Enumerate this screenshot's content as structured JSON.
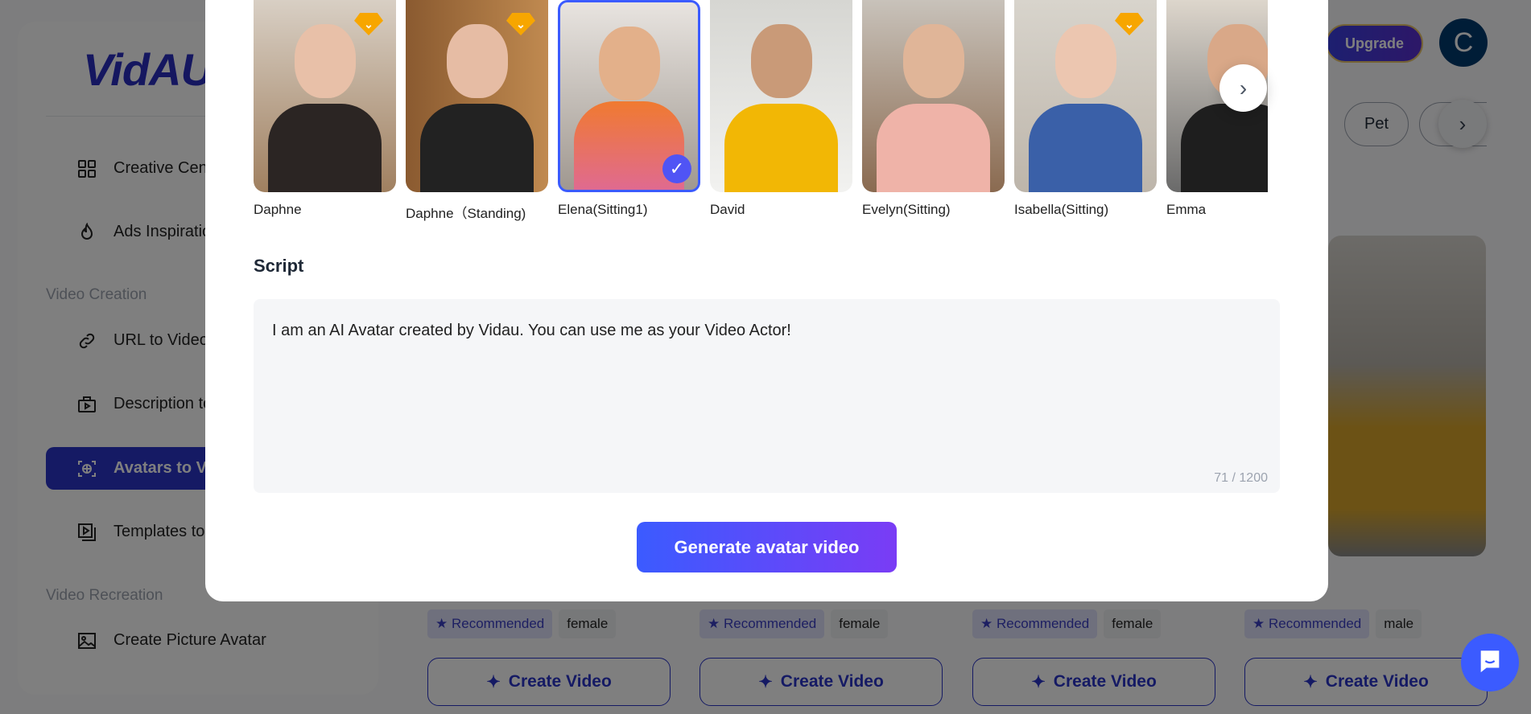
{
  "app": {
    "logo": "VidAU",
    "upgrade": "Upgrade",
    "user_initial": "C"
  },
  "sidebar": {
    "items": [
      {
        "label": "Creative Center",
        "icon": "grid-icon"
      },
      {
        "label": "Ads Inspiration",
        "icon": "flame-icon"
      },
      {
        "label": "URL to Video",
        "icon": "link-icon"
      },
      {
        "label": "Description to Video",
        "icon": "video-bag-icon"
      },
      {
        "label": "Avatars to Video",
        "icon": "avatar-scan-icon",
        "active": true
      },
      {
        "label": "Templates to Video",
        "icon": "template-icon"
      },
      {
        "label": "Create Picture Avatar",
        "icon": "image-icon"
      }
    ],
    "sections": [
      "Video Creation",
      "Video Recreation"
    ]
  },
  "filters": {
    "pills": [
      "Pet"
    ]
  },
  "background_cards": [
    {
      "tags": [
        "Recommended",
        "female"
      ],
      "button": "Create Video"
    },
    {
      "tags": [
        "Recommended",
        "female"
      ],
      "button": "Create Video"
    },
    {
      "tags": [
        "Recommended",
        "female"
      ],
      "button": "Create Video"
    },
    {
      "tags": [
        "Recommended",
        "male"
      ],
      "button": "Create Video"
    }
  ],
  "modal": {
    "avatars": [
      {
        "name": "Daphne",
        "premium": true,
        "selected": false
      },
      {
        "name": "Daphne（Standing)",
        "premium": true,
        "selected": false
      },
      {
        "name": "Elena(Sitting1)",
        "premium": false,
        "selected": true
      },
      {
        "name": "David",
        "premium": false,
        "selected": false
      },
      {
        "name": "Evelyn(Sitting)",
        "premium": false,
        "selected": false
      },
      {
        "name": "Isabella(Sitting)",
        "premium": true,
        "selected": false
      },
      {
        "name": "Emma",
        "premium": false,
        "selected": false
      }
    ],
    "script_label": "Script",
    "script_value": "I am an AI Avatar created by Vidau. You can use me as your Video Actor!",
    "char_count": "71 / 1200",
    "generate": "Generate avatar video"
  },
  "colors": {
    "brand": "#2b35c9",
    "accent": "#3b5bff",
    "premium": "#f7a600"
  }
}
